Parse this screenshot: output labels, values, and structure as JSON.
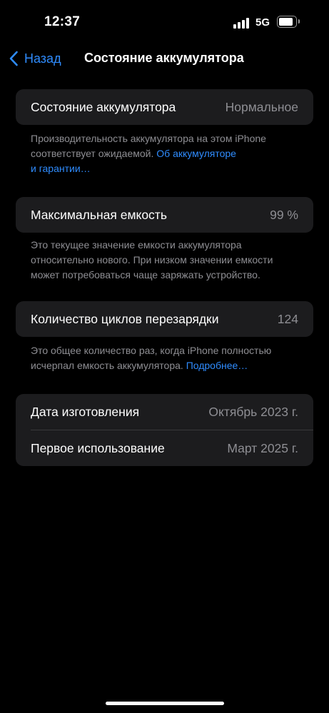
{
  "status_bar": {
    "time": "12:37",
    "network": "5G",
    "battery_level": 0.85
  },
  "nav": {
    "back_label": "Назад",
    "title": "Состояние аккумулятора"
  },
  "health": {
    "label": "Состояние аккумулятора",
    "value": "Нормальное",
    "note_text": "Производительность аккумулятора на этом iPhone соответствует ожидаемой. ",
    "note_link_1": "Об аккумуляторе",
    "note_link_2": "и гарантии…"
  },
  "capacity": {
    "label": "Максимальная емкость",
    "value": "99 %",
    "note_line_1": "Это текущее значение емкости аккумулятора",
    "note_line_2": "относительно нового. При низком значении емкости",
    "note_line_3": "может потребоваться чаще заряжать устройство."
  },
  "cycles": {
    "label": "Количество циклов перезарядки",
    "value": "124",
    "note_line_1": "Это общее количество раз, когда iPhone полностью",
    "note_line_2": "исчерпал емкость аккумулятора. ",
    "note_link": "Подробнее…"
  },
  "dates": {
    "manufacture_label": "Дата изготовления",
    "manufacture_value": "Октябрь 2023 г.",
    "first_use_label": "Первое использование",
    "first_use_value": "Март 2025 г."
  },
  "colors": {
    "accent": "#2f8cff",
    "cell_bg": "#1c1c1e",
    "secondary_text": "#8e8e93"
  }
}
